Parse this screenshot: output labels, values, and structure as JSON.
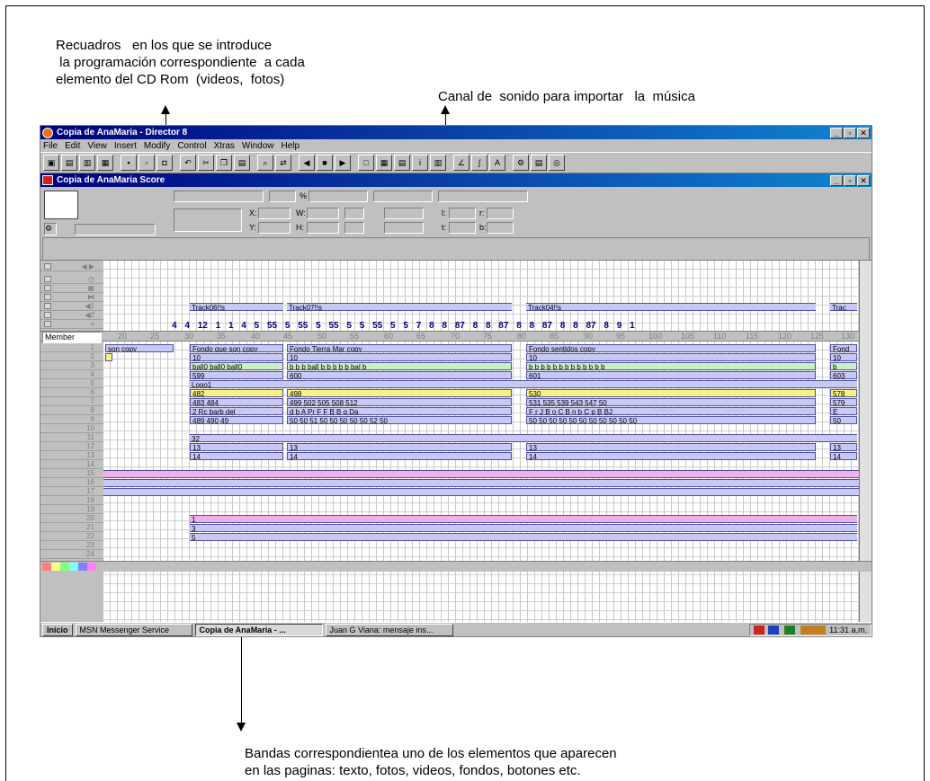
{
  "annotations": {
    "top_left": "Recuadros   en los que se introduce\n la programación correspondiente  a cada\nelemento del CD Rom  (videos,  fotos)",
    "top_right": "Canal de  sonido para importar   la  música",
    "bottom": "Bandas correspondientea uno de los elementos que aparecen\nen las paginas: texto, fotos, videos, fondos, botones etc."
  },
  "app": {
    "title": "Copia de AnaMaria - Director 8",
    "window_buttons": [
      "_",
      "▫",
      "✕"
    ],
    "menu": [
      "File",
      "Edit",
      "View",
      "Insert",
      "Modify",
      "Control",
      "Xtras",
      "Window",
      "Help"
    ]
  },
  "score": {
    "title": "Copia de AnaMaria Score",
    "props": {
      "x": "X:",
      "y": "Y:",
      "w": "W:",
      "h": "H:",
      "l": "l:",
      "t": "t:",
      "r": "r:",
      "b": "b:",
      "pct": "%"
    },
    "member_label": "Member",
    "frame_numbers": [
      "20",
      "25",
      "30",
      "35",
      "40",
      "45",
      "50",
      "55",
      "60",
      "65",
      "70",
      "75",
      "80",
      "85",
      "90",
      "95",
      "100",
      "105",
      "110",
      "115",
      "120",
      "125",
      "130"
    ],
    "tempo_values": [
      "4",
      "4",
      "12",
      "1",
      "1",
      "4",
      "5",
      "55",
      "5",
      "55",
      "5",
      "55",
      "5",
      "5",
      "55",
      "5",
      "5",
      "7",
      "8",
      "8",
      "87",
      "8",
      "8",
      "87",
      "8",
      "8",
      "87",
      "8",
      "8",
      "87",
      "8",
      "9",
      "1"
    ],
    "sound_tracks": {
      "s1a": "Track06!!s",
      "s1b": "Track07!!s",
      "s1c": "Track04!!s",
      "s1d": "Trac"
    },
    "channels": [
      "1",
      "2",
      "3",
      "4",
      "5",
      "6",
      "7",
      "8",
      "9",
      "10",
      "11",
      "12",
      "13",
      "14",
      "15",
      "16",
      "17",
      "18",
      "19",
      "20",
      "21",
      "22",
      "23",
      "24"
    ],
    "sprites": {
      "c1a": "son copy",
      "c1b": "Fondo que son copy",
      "c1c": "Fondo Tierra Mar copy",
      "c1d": "Fondo sentidos copy",
      "c1e": "Fond",
      "c2a": "10",
      "c2b": "10",
      "c2c": "10",
      "c2d": "10",
      "c3a": "ball0 ball0 ball0",
      "c3b": "b b b ball b b b b b bal b",
      "c3c": "b b b b b b b b b b b b b",
      "c3d": "b",
      "c4a": "599",
      "c4b": "600",
      "c4c": "601",
      "c4d": "603",
      "c5a": "Logo1",
      "c6a": "482",
      "c6b": "498",
      "c6c": "530",
      "c6d": "578",
      "c7a": "483 484",
      "c7b": "499 502 505 508 512",
      "c7c": "531 535 539 543 547 50",
      "c7d": "579",
      "c8a": "2 Rc barb del",
      "c8b": "d b A Pr F F B B g Da",
      "c8c": "F r J B o C B n b C p B BJ",
      "c8d": "E",
      "c9a": "489 490 49",
      "c9b": "50 50 51 50 50 50 50 50 52 50",
      "c9c": "50 50 50 50 50 50 50 50 50 50 50",
      "c9d": "50",
      "c11a": "32",
      "c12a": "13",
      "c12b": "13",
      "c12c": "13",
      "c12d": "13",
      "c13a": "14",
      "c13b": "14",
      "c13c": "14",
      "c13d": "14",
      "c20a": "1",
      "c21a": "3",
      "c22a": "5"
    }
  },
  "taskbar": {
    "start": "Inicio",
    "tasks": [
      "MSN Messenger Service",
      "Copia de AnaMaria - ...",
      "Juan G Viana: mensaje ins..."
    ],
    "clock": "11:31 a.m."
  }
}
